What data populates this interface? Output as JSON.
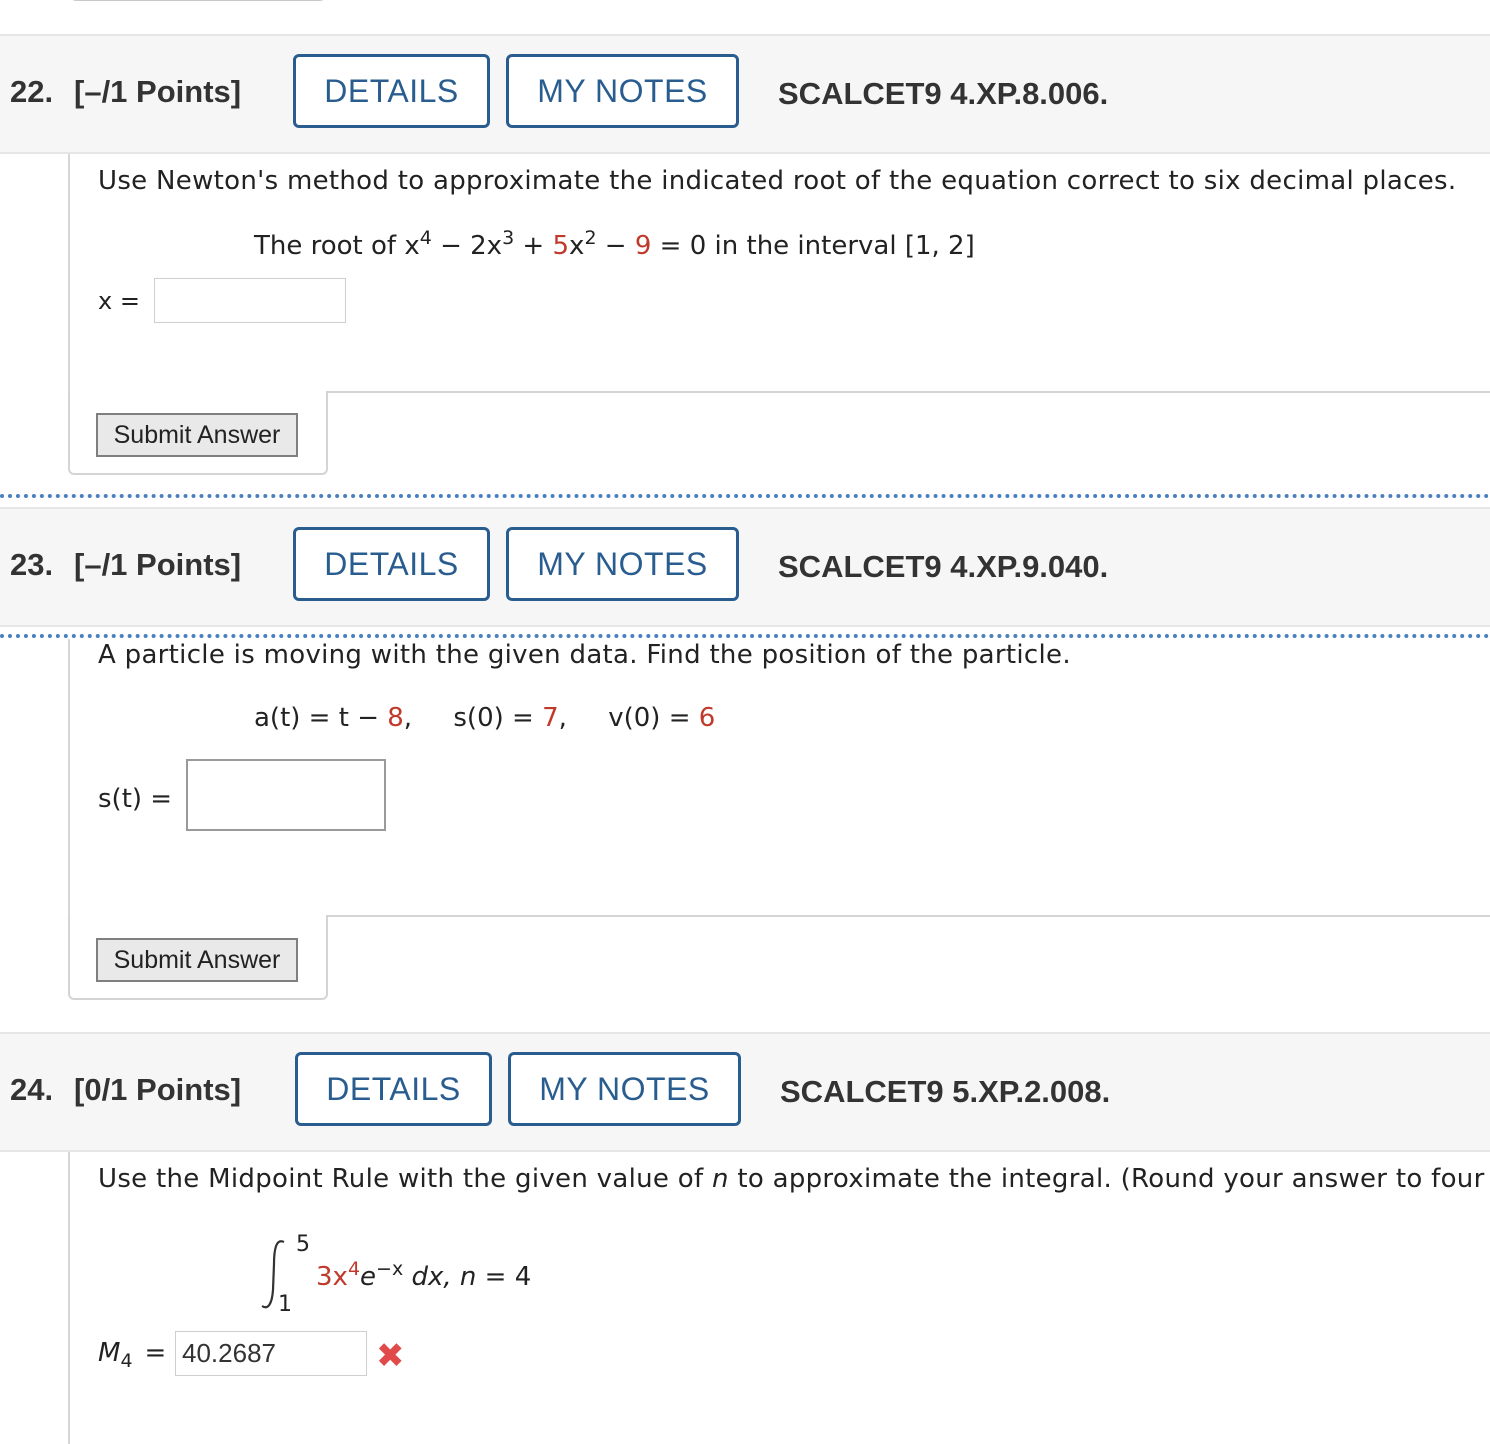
{
  "questions": [
    {
      "number": "22.",
      "points": "[–/1 Points]",
      "details_label": "DETAILS",
      "notes_label": "MY NOTES",
      "code": "SCALCET9 4.XP.8.006.",
      "prompt": "Use Newton's method to approximate the indicated root of the equation correct to six decimal places.",
      "answer_label": "x =",
      "answer_value": "",
      "submit_label": "Submit Answer"
    },
    {
      "number": "23.",
      "points": "[–/1 Points]",
      "details_label": "DETAILS",
      "notes_label": "MY NOTES",
      "code": "SCALCET9 4.XP.9.040.",
      "prompt": "A particle is moving with the given data. Find the position of the particle.",
      "answer_label": "s(t) =",
      "answer_value": "",
      "submit_label": "Submit Answer"
    },
    {
      "number": "24.",
      "points": "[0/1 Points]",
      "details_label": "DETAILS",
      "notes_label": "MY NOTES",
      "code": "SCALCET9 5.XP.2.008.",
      "prompt_before_n": "Use the Midpoint Rule with the given value of ",
      "prompt_n": "n",
      "prompt_after_n": " to approximate the integral. (Round your answer to four d",
      "answer_label": "M",
      "answer_sub": "4",
      "answer_eq": "=",
      "answer_value": "40.2687",
      "status_icon": "incorrect-x-icon"
    }
  ],
  "q22_math": {
    "lead": "The root of x",
    "exp4": "4",
    "minus1": " − 2x",
    "exp3": "3",
    "plus": " + ",
    "coef5": "5",
    "x": "x",
    "exp2": "2",
    "minus2": " − ",
    "nine": "9",
    "tail": " = 0 in the interval [1, 2]"
  },
  "q23_math": {
    "a_lhs": "a(t) = t − ",
    "a_val": "8",
    "s_lhs": ",     s(0) = ",
    "s_val": "7",
    "v_lhs": ",     v(0) = ",
    "v_val": "6"
  },
  "q24_math": {
    "upper": "5",
    "lower": "1",
    "integrand_coef": "3x",
    "integrand_exp": "4",
    "integrand_e": "e",
    "integrand_eexp": "−x",
    "tail_dx": " dx, ",
    "tail_n": "n",
    "tail_eq": " = 4"
  },
  "colors": {
    "button_blue": "#2a5d8f",
    "given_red": "#c0392b",
    "wrong_red": "#e04a4a"
  }
}
